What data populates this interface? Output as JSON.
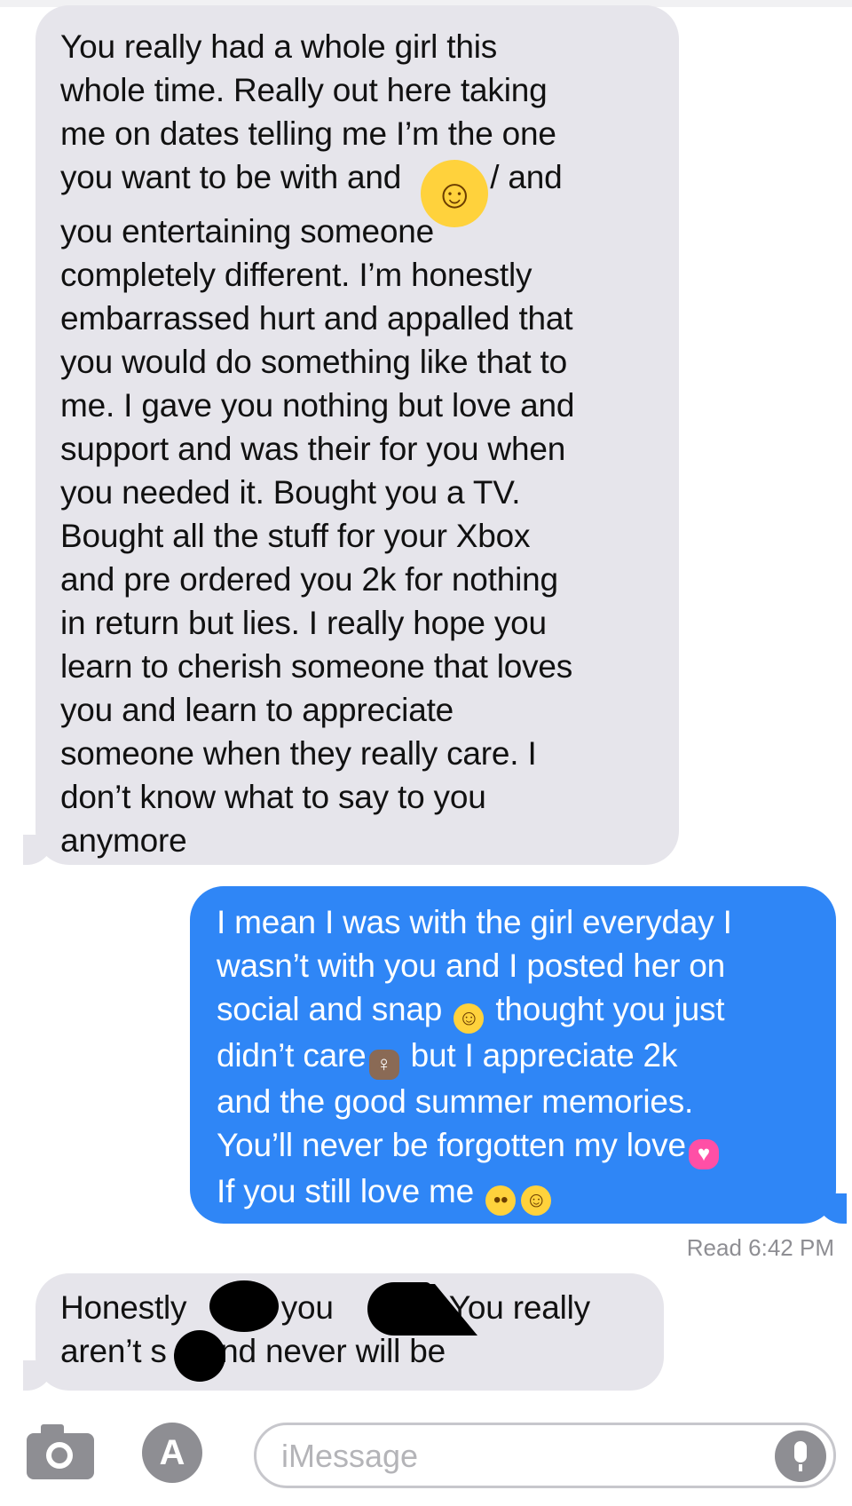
{
  "thread": {
    "received_1": {
      "lines": [
        "You really had a whole girl this",
        "whole time. Really out here taking",
        "me on dates telling me I’m the one",
        "you want to be with and",
        "you entertaining someone",
        "completely different. I’m honestly",
        "embarrassed hurt and appalled that",
        "you would do something like that to",
        "me. I gave you nothing but love and",
        "support and was their for you when",
        "you needed it. Bought you a TV.",
        "Bought all the stuff for your Xbox",
        "and pre ordered you 2k for nothing",
        "in return but lies. I really hope you",
        "learn to cherish someone that loves",
        "you and learn to appreciate",
        "someone when they really care. I",
        "don’t know what to say to you",
        "anymore"
      ],
      "line4_tail": "/ and"
    },
    "sent_1": {
      "lines": [
        "I mean I was with the girl everyday I",
        "wasn’t with you and I posted her on",
        "social and snap",
        "thought you just",
        "didn’t care",
        "but I appreciate 2k",
        "and the good summer memories.",
        "You’ll never be forgotten my love",
        "If you still love me"
      ]
    },
    "receipt": "Read 6:42 PM",
    "received_2": {
      "line1_a": "Honestly",
      "line1_b": "k you",
      "line1_c": "You really",
      "line2_a": "aren’t s",
      "line2_b": "and never will be"
    },
    "emojis": {
      "blush": "☺",
      "grin": "☺",
      "person": "♀",
      "hearts": "♥",
      "pleading": "••",
      "smile": "☺"
    }
  },
  "input_bar": {
    "placeholder": "iMessage",
    "camera_icon": "camera-icon",
    "apps_icon": "app-store-icon",
    "apps_glyph": "A",
    "mic_icon": "microphone-icon"
  },
  "colors": {
    "incoming_bubble": "#e6e5eb",
    "outgoing_bubble": "#2f86f6",
    "receipt_text": "#8e8e93"
  }
}
